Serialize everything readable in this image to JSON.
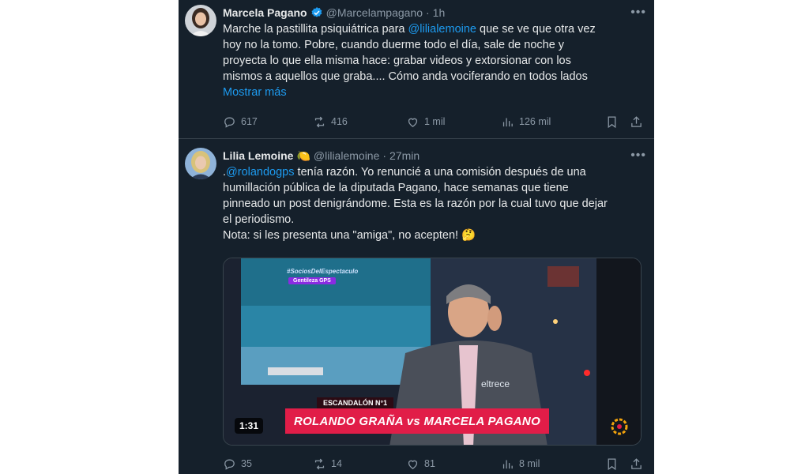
{
  "tweets": [
    {
      "name": "Marcela Pagano",
      "handle": "@Marcelampagano",
      "separator": "·",
      "time": "1h",
      "body_before": "Marche la pastillita psiquiátrica para ",
      "mention": "@lilialemoine",
      "body_after": " que se ve que otra vez\nhoy no la tomo. Pobre, cuando duerme todo el día, sale de noche y\nproyecta lo que ella misma hace: grabar videos y extorsionar con los\nmismos a aquellos que graba.... Cómo anda vociferando en todos lados",
      "show_more": "Mostrar más",
      "replies": "617",
      "retweets": "416",
      "likes": "1 mil",
      "views": "126 mil"
    },
    {
      "name": "Lilia Lemoine",
      "badge_emoji": "🍋",
      "handle": "@lilialemoine",
      "separator": "·",
      "time": "27min",
      "body_before": ".",
      "mention": "@rolandogps",
      "body_after": " tenía razón. Yo renuncié a una comisión después de una\nhumillación pública de la diputada Pagano, hace semanas que tiene\npinneado un post denigrándome. Esta es la razón por la cual tuvo que dejar\nel periodismo.\nNota: si les presenta una \"amiga\", no acepten! 🤔",
      "video": {
        "tag_top": "#SociosDelEspectaculo",
        "tag_pill": "Gentileza GPS",
        "chyron_small": "ESCANDALÓN N°1",
        "chyron_main": "ROLANDO GRAÑA vs MARCELA PAGANO",
        "channel": "eltrece",
        "duration": "1:31"
      },
      "replies": "35",
      "retweets": "14",
      "likes": "81",
      "views": "8 mil"
    }
  ],
  "icons": {
    "more": "more-horizontal-icon",
    "reply": "reply-icon",
    "retweet": "retweet-icon",
    "like": "heart-icon",
    "views": "views-icon",
    "bookmark": "bookmark-icon",
    "share": "share-icon",
    "verified": "verified-badge-icon"
  },
  "colors": {
    "background": "#15202b",
    "text": "#e7e9ea",
    "muted": "#8b98a5",
    "link": "#1d9bf0",
    "verified": "#1d9bf0",
    "chyron": "#e11d48"
  }
}
